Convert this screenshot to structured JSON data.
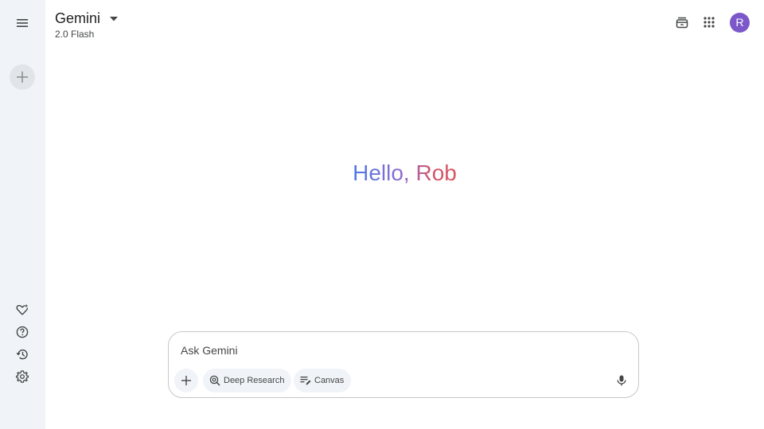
{
  "header": {
    "model_name": "Gemini",
    "model_version": "2.0 Flash"
  },
  "sidebar": {
    "icons": [
      "menu-icon",
      "plus-icon",
      "gem-icon",
      "help-icon",
      "history-icon",
      "settings-icon"
    ]
  },
  "top_right": {
    "icons": [
      "upgrade-icon",
      "apps-grid-icon"
    ],
    "avatar_letter": "R"
  },
  "greeting": {
    "text": "Hello, Rob"
  },
  "composer": {
    "placeholder": "Ask Gemini",
    "chips": [
      {
        "label": "Deep Research",
        "icon": "deep-research-icon"
      },
      {
        "label": "Canvas",
        "icon": "canvas-icon"
      }
    ]
  },
  "colors": {
    "sidebar_bg": "#f0f4f9",
    "avatar_bg": "#7b57c9",
    "greeting_start": "#4f7be6",
    "greeting_end": "#d9555f"
  }
}
